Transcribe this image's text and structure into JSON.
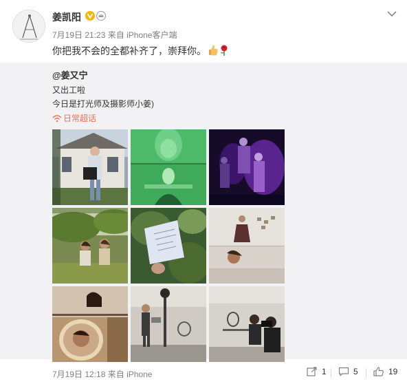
{
  "author": {
    "name": "姜凯阳",
    "time": "7月19日 21:23",
    "source_prefix": "来自",
    "source": "iPhone客户端",
    "text": "你把我不会的全都补齐了，崇拜你。"
  },
  "repost": {
    "author": "@姜又宁",
    "line1": "又出工啦",
    "line2": "今日是打光师及摄影师小姜)",
    "supertopic": "日常超话",
    "photos": [
      {
        "desc": "girl-with-bag-outdoor"
      },
      {
        "desc": "green-light-portrait"
      },
      {
        "desc": "purple-party"
      },
      {
        "desc": "girls-on-grass"
      },
      {
        "desc": "hand-holding-note"
      },
      {
        "desc": "dancer-white-wall"
      },
      {
        "desc": "mirror-portrait"
      },
      {
        "desc": "lighting-setup"
      },
      {
        "desc": "camera-crew-room"
      }
    ],
    "time": "7月19日 12:18",
    "source_prefix": "来自",
    "source": "iPhone",
    "repost_count": "1",
    "comment_count": "5",
    "like_count": "19"
  },
  "colors": {
    "accent": "#eb7350",
    "badge": "#f7b500",
    "repost_bg": "#f2f2f5"
  }
}
